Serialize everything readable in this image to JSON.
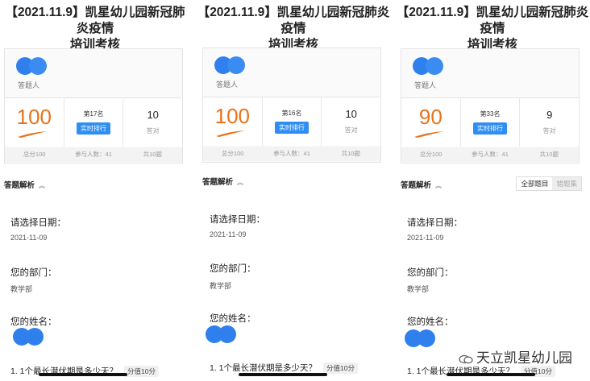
{
  "panels": [
    {
      "title_line1": "【2021.11.9】凯星幼儿园新冠肺炎疫情",
      "title_line2": "培训考核",
      "answerer_label": "答题人",
      "score": "100",
      "rank": "第17名",
      "rank_button": "实时排行",
      "correct": "10",
      "correct_label": "答对",
      "total_score": "总分100",
      "participants": "参与人数：41",
      "total_questions": "共10题",
      "analysis_label": "答题解析",
      "q1": "请选择日期：",
      "a1": "2021-11-09",
      "q2": "您的部门：",
      "a2": "教学部",
      "q3": "您的姓名：",
      "q4": "1. 1个最长潜伏期是多少天？",
      "q4_points": "分值10分"
    },
    {
      "title_line1": "【2021.11.9】凯星幼儿园新冠肺炎疫情",
      "title_line2": "培训考核",
      "answerer_label": "答题人",
      "score": "100",
      "rank": "第16名",
      "rank_button": "实时排行",
      "correct": "10",
      "correct_label": "答对",
      "total_score": "总分100",
      "participants": "参与人数：41",
      "total_questions": "共10题",
      "analysis_label": "答题解析",
      "q1": "请选择日期：",
      "a1": "2021-11-09",
      "q2": "您的部门：",
      "a2": "教学部",
      "q3": "您的姓名：",
      "q4": "1. 1个最长潜伏期是多少天？",
      "q4_points": "分值10分"
    },
    {
      "title_line1": "【2021.11.9】凯星幼儿园新冠肺炎疫情",
      "title_line2": "培训考核",
      "answerer_label": "答题人",
      "score": "90",
      "rank": "第33名",
      "rank_button": "实时排行",
      "correct": "9",
      "correct_label": "答对",
      "total_score": "总分100",
      "participants": "参与人数：41",
      "total_questions": "共10题",
      "analysis_label": "答题解析",
      "tab_all": "全部题目",
      "tab_wrong": "错题集",
      "q1": "请选择日期：",
      "a1": "2021-11-09",
      "q2": "您的部门：",
      "a2": "教学部",
      "q3": "您的姓名：",
      "q4": "1. 1个最长潜伏期是多少天？",
      "q4_points": "分值10分"
    }
  ],
  "watermark": "天立凯星幼儿园",
  "colors": {
    "score": "#e8731c",
    "accent": "#2f8ef4",
    "avatar": "#2f80ed"
  }
}
